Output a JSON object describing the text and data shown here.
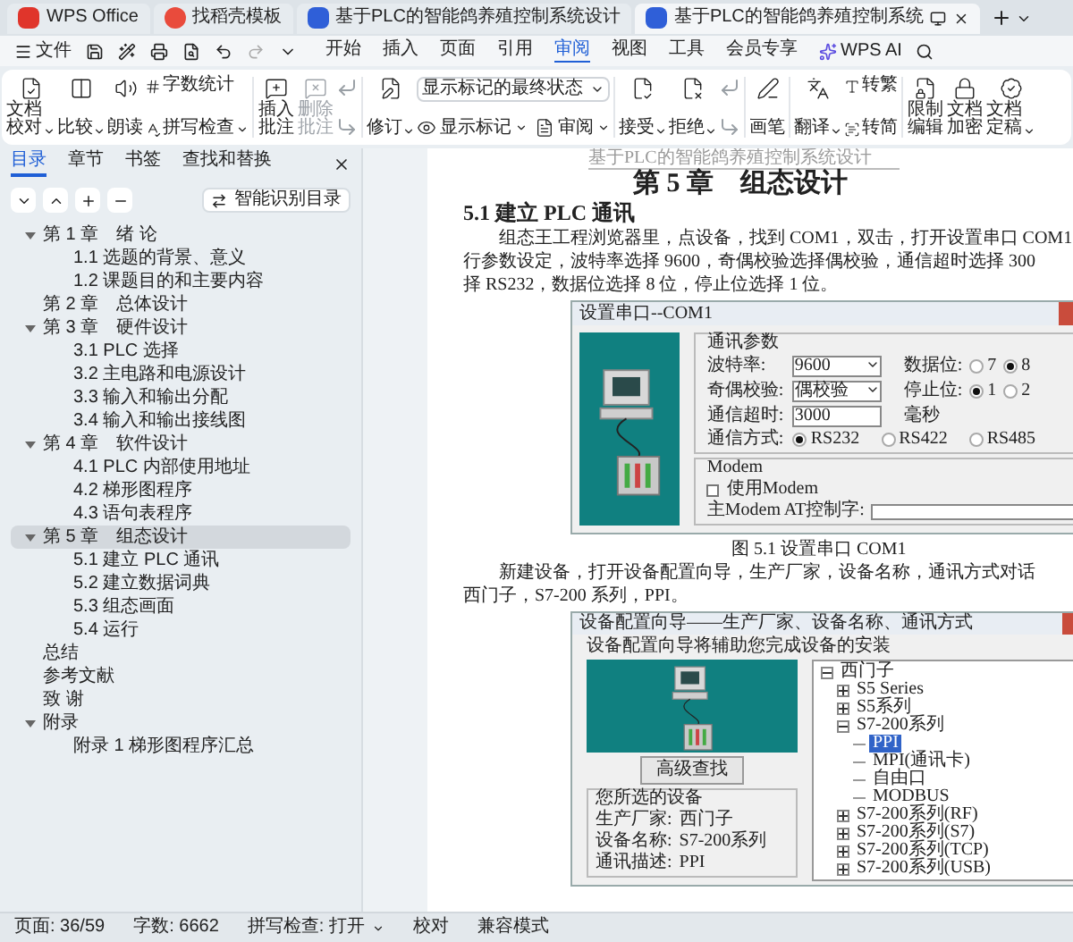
{
  "tabs": [
    {
      "label": "WPS Office",
      "kind": "wps",
      "selected": false
    },
    {
      "label": "找稻壳模板",
      "kind": "template",
      "selected": false
    },
    {
      "label": "基于PLC的智能鸽养殖控制系统设计",
      "kind": "doc",
      "selected": false
    },
    {
      "label": "基于PLC的智能鸽养殖控制系统",
      "kind": "doc",
      "selected": true
    }
  ],
  "menu": {
    "file": "文件",
    "items": [
      {
        "label": "开始",
        "selected": false
      },
      {
        "label": "插入",
        "selected": false
      },
      {
        "label": "页面",
        "selected": false
      },
      {
        "label": "引用",
        "selected": false
      },
      {
        "label": "审阅",
        "selected": true
      },
      {
        "label": "视图",
        "selected": false
      },
      {
        "label": "工具",
        "selected": false
      },
      {
        "label": "会员专享",
        "selected": false
      }
    ],
    "ai": "WPS AI"
  },
  "ribbon": [
    [
      {
        "kind": "large",
        "label": "文档校对",
        "caret": true
      },
      {
        "kind": "large",
        "label": "比较",
        "caret": true
      },
      {
        "kind": "large",
        "label": "朗读",
        "caret": false
      },
      {
        "kind": "stack",
        "items": [
          {
            "label": "字数统计",
            "caret": false
          },
          {
            "label": "拼写检查",
            "caret": true
          }
        ]
      }
    ],
    [
      {
        "kind": "large",
        "label": "插入批注",
        "caret": false,
        "disabled": false
      },
      {
        "kind": "large",
        "label": "删除批注",
        "caret": false,
        "disabled": true
      },
      {
        "kind": "icons"
      }
    ],
    [
      {
        "kind": "large",
        "label": "修订",
        "caret": true
      },
      {
        "kind": "review",
        "select": "显示标记的最终状态",
        "items": [
          {
            "label": "显示标记",
            "caret": true
          },
          {
            "label": "审阅",
            "caret": true
          }
        ]
      }
    ],
    [
      {
        "kind": "large",
        "label": "接受",
        "caret": true
      },
      {
        "kind": "large",
        "label": "拒绝",
        "caret": true
      },
      {
        "kind": "icons"
      }
    ],
    [
      {
        "kind": "large",
        "label": "画笔",
        "caret": false
      }
    ],
    [
      {
        "kind": "large",
        "label": "翻译",
        "caret": true
      },
      {
        "kind": "stack",
        "items": [
          {
            "label": "转繁",
            "caret": false
          },
          {
            "label": "转简",
            "caret": false
          }
        ]
      }
    ],
    [
      {
        "kind": "large",
        "label": "限制编辑",
        "caret": false
      },
      {
        "kind": "large",
        "label": "文档加密",
        "caret": false
      },
      {
        "kind": "large",
        "label": "文档定稿",
        "caret": true
      }
    ]
  ],
  "panel": {
    "tabs": [
      {
        "label": "目录",
        "selected": true
      },
      {
        "label": "章节",
        "selected": false
      },
      {
        "label": "书签",
        "selected": false
      },
      {
        "label": "查找和替换",
        "selected": false
      }
    ],
    "smart_toc": "智能识别目录",
    "toc": [
      {
        "label": "第 1 章　绪 论",
        "expanded": true,
        "selected": false,
        "children": [
          {
            "label": "1.1 选题的背景、意义",
            "selected": false
          },
          {
            "label": "1.2 课题目的和主要内容",
            "selected": false
          }
        ]
      },
      {
        "label": "第 2 章　总体设计",
        "selected": false
      },
      {
        "label": "第 3 章　硬件设计",
        "expanded": true,
        "selected": false,
        "children": [
          {
            "label": "3.1 PLC 选择",
            "selected": false
          },
          {
            "label": "3.2  主电路和电源设计",
            "selected": false
          },
          {
            "label": "3.3  输入和输出分配",
            "selected": false
          },
          {
            "label": "3.4  输入和输出接线图",
            "selected": false
          }
        ]
      },
      {
        "label": "第 4 章　软件设计",
        "expanded": true,
        "selected": false,
        "children": [
          {
            "label": "4.1 PLC 内部使用地址",
            "selected": false
          },
          {
            "label": "4.2  梯形图程序",
            "selected": false
          },
          {
            "label": "4.3  语句表程序",
            "selected": false
          }
        ]
      },
      {
        "label": "第 5 章　组态设计",
        "expanded": true,
        "selected": true,
        "children": [
          {
            "label": "5.1 建立 PLC 通讯",
            "selected": false
          },
          {
            "label": "5.2  建立数据词典",
            "selected": false
          },
          {
            "label": "5.3  组态画面",
            "selected": false
          },
          {
            "label": "5.4 运行",
            "selected": false
          }
        ]
      },
      {
        "label": "总结",
        "selected": false
      },
      {
        "label": "参考文献",
        "selected": false
      },
      {
        "label": "致 谢",
        "selected": false
      },
      {
        "label": "附录",
        "expanded": true,
        "selected": false,
        "children": [
          {
            "label": "附录 1  梯形图程序汇总",
            "selected": false
          }
        ]
      }
    ]
  },
  "document": {
    "header": "基于PLC的智能鸽养殖控制系统设计",
    "chapter": "第 5 章　组态设计",
    "section": "5.1 建立 PLC 通讯",
    "paragraph_1": [
      "组态王工程浏览器里，点设备，找到 COM1，双击，打开设置串口 COM1",
      "行参数设定，波特率选择 9600，奇偶校验选择偶校验，通信超时选择 300",
      "择 RS232，数据位选择 8 位，停止位选择 1 位。"
    ],
    "figure_1": {
      "title": "设置串口--COM1",
      "group": "通讯参数",
      "baud_label": "波特率:",
      "baud": "9600",
      "data_bits_label": "数据位:",
      "data_bits": [
        {
          "label": "7",
          "selected": false
        },
        {
          "label": "8",
          "selected": true
        }
      ],
      "parity_label": "奇偶校验:",
      "parity": "偶校验",
      "stop_bits_label": "停止位:",
      "stop_bits": [
        {
          "label": "1",
          "selected": true
        },
        {
          "label": "2",
          "selected": false
        }
      ],
      "timeout_label": "通信超时:",
      "timeout": "3000",
      "timeout_unit": "毫秒",
      "mode_label": "通信方式:",
      "modes": [
        {
          "label": "RS232",
          "selected": true
        },
        {
          "label": "RS422",
          "selected": false
        },
        {
          "label": "RS485",
          "selected": false
        }
      ],
      "modem_group": "Modem",
      "use_modem": {
        "label": "使用Modem",
        "checked": false
      },
      "at_label": "主Modem AT控制字:"
    },
    "caption_1": "图 5.1 设置串口 COM1",
    "paragraph_2": [
      "新建设备，打开设备配置向导，生产厂家，设备名称，通讯方式对话",
      "西门子，S7-200 系列，PPI。"
    ],
    "figure_2": {
      "title": "设备配置向导——生产厂家、设备名称、通讯方式",
      "intro": "设备配置向导将辅助您完成设备的安装",
      "tree": [
        {
          "label": "西门子",
          "expanded": true,
          "selected": false,
          "children": [
            {
              "label": "S5 Series",
              "expanded": false,
              "selected": false
            },
            {
              "label": "S5系列",
              "expanded": false,
              "selected": false
            },
            {
              "label": "S7-200系列",
              "expanded": true,
              "selected": false,
              "children": [
                {
                  "label": "PPI",
                  "selected": true
                },
                {
                  "label": "MPI(通讯卡)",
                  "selected": false
                },
                {
                  "label": "自由口",
                  "selected": false
                },
                {
                  "label": "MODBUS",
                  "selected": false
                }
              ]
            },
            {
              "label": "S7-200系列(RF)",
              "expanded": false,
              "selected": false
            },
            {
              "label": "S7-200系列(S7)",
              "expanded": false,
              "selected": false
            },
            {
              "label": "S7-200系列(TCP)",
              "expanded": false,
              "selected": false
            },
            {
              "label": "S7-200系列(USB)",
              "expanded": false,
              "selected": false
            }
          ]
        }
      ],
      "group": "您所选的设备",
      "fields": [
        {
          "label": "生产厂家:",
          "value": "西门子"
        },
        {
          "label": "设备名称:",
          "value": "S7-200系列"
        },
        {
          "label": "通讯描述:",
          "value": "PPI"
        }
      ],
      "button": "高级查找"
    }
  },
  "status_bar": [
    {
      "label": "页面: 36/59",
      "caret": false
    },
    {
      "label": "字数: 6662",
      "caret": false
    },
    {
      "label": "拼写检查: 打开",
      "caret": true
    },
    {
      "label": "校对",
      "caret": false
    },
    {
      "label": "兼容模式",
      "caret": false
    }
  ]
}
